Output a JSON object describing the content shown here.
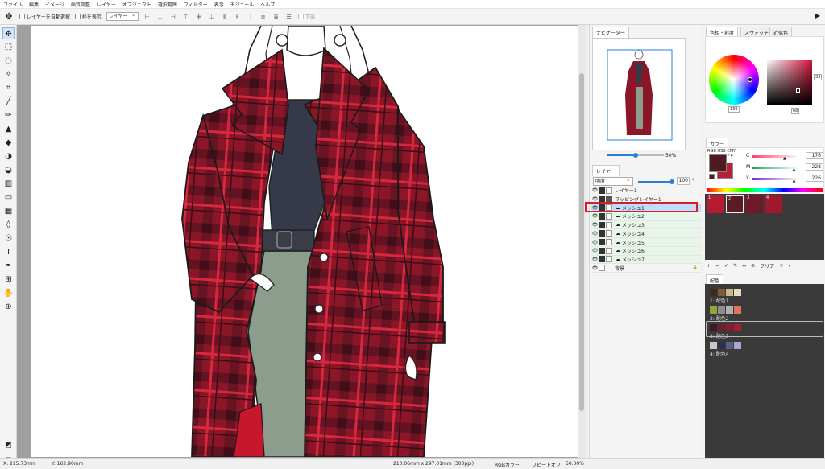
{
  "menu": [
    "ファイル",
    "編集",
    "イメージ",
    "画質調整",
    "レイヤー",
    "オブジェクト",
    "選択範囲",
    "フィルター",
    "表示",
    "モジュール",
    "ヘルプ"
  ],
  "options": {
    "auto_select_label": "レイヤーを自動選択",
    "show_frame_label": "枠を表示",
    "select_value": "レイヤー",
    "bottom_label": "下端"
  },
  "tools": [
    "move-tool-icon",
    "marquee-tool-icon",
    "lasso-tool-icon",
    "magic-wand-icon",
    "crop-icon",
    "eyedropper-icon",
    "brush-icon",
    "stamp-icon",
    "eraser-icon",
    "fill-icon",
    "fill-alt-icon",
    "pattern-icon",
    "rect-shape-icon",
    "mesh-icon",
    "drop-icon",
    "smudge-icon",
    "text-tool-icon",
    "pen-tool-icon",
    "transform-icon",
    "hand-icon",
    "zoom-icon"
  ],
  "navigator": {
    "tab": "ナビゲーター",
    "zoom": "50%",
    "zoom_fraction": 0.5
  },
  "layers": {
    "tab": "レイヤー",
    "blend_mode": "明度",
    "opacity": "100",
    "opacity_fraction": 1.0,
    "items": [
      {
        "name": "レイヤー1",
        "type": "normal"
      },
      {
        "name": "マッピングレイヤー1",
        "type": "folder"
      },
      {
        "name": "メッシュ1",
        "type": "mesh",
        "selected": true
      },
      {
        "name": "メッシュ2",
        "type": "mesh"
      },
      {
        "name": "メッシュ3",
        "type": "mesh"
      },
      {
        "name": "メッシュ4",
        "type": "mesh"
      },
      {
        "name": "メッシュ5",
        "type": "mesh"
      },
      {
        "name": "メッシュ6",
        "type": "mesh"
      },
      {
        "name": "メッシュ7",
        "type": "mesh"
      },
      {
        "name": "背景",
        "type": "background"
      }
    ]
  },
  "color_panel": {
    "tabs": [
      "色相・彩度",
      "スウォッチ",
      "近似色"
    ],
    "hue_value": "339",
    "sv_value": "68",
    "side_value": "33"
  },
  "color_values": {
    "tab": "カラー",
    "mode_label": "RGB HSB CMY",
    "c_label": "C",
    "c_value": "176",
    "c_fraction": 0.69,
    "m_label": "M",
    "m_value": "228",
    "m_fraction": 0.89,
    "y_label": "Y",
    "y_value": "226",
    "y_fraction": 0.89,
    "fg_color": "#4f1b21",
    "bg_color": "#b81e35"
  },
  "swatch_strip": {
    "labels": [
      "1",
      "2",
      "3",
      "4"
    ],
    "colors": [
      "#b51c31",
      "#5c1a23",
      "#6e1a2a",
      "#a0182e"
    ],
    "clear_label": "クリア"
  },
  "palette": {
    "tab": "配色",
    "groups": [
      {
        "label": "1: 配色1",
        "colors": [
          "#3d2b1f",
          "#7a5c3a",
          "#c9b98f",
          "#e6dcbc"
        ]
      },
      {
        "label": "2: 配色2",
        "colors": [
          "#8fa63a",
          "#8e8e8e",
          "#b0b0b0",
          "#e0735a"
        ]
      },
      {
        "label": "3: 配色3",
        "colors": [
          "#3a1c22",
          "#6b1f2d",
          "#8a1a30",
          "#a61f36"
        ]
      },
      {
        "label": "4: 配色4",
        "colors": [
          "#c8c8c8",
          "#2d3150",
          "#5a5f86",
          "#a8a8d0"
        ]
      }
    ]
  },
  "status": {
    "x": "X: 215.73mm",
    "y": "Y: 162.90mm",
    "doc_size": "210.06mm x 297.01mm (300ppi)",
    "color_mode": "RGBカラー",
    "repeat": "リピートオフ",
    "zoom": "50.00%"
  }
}
